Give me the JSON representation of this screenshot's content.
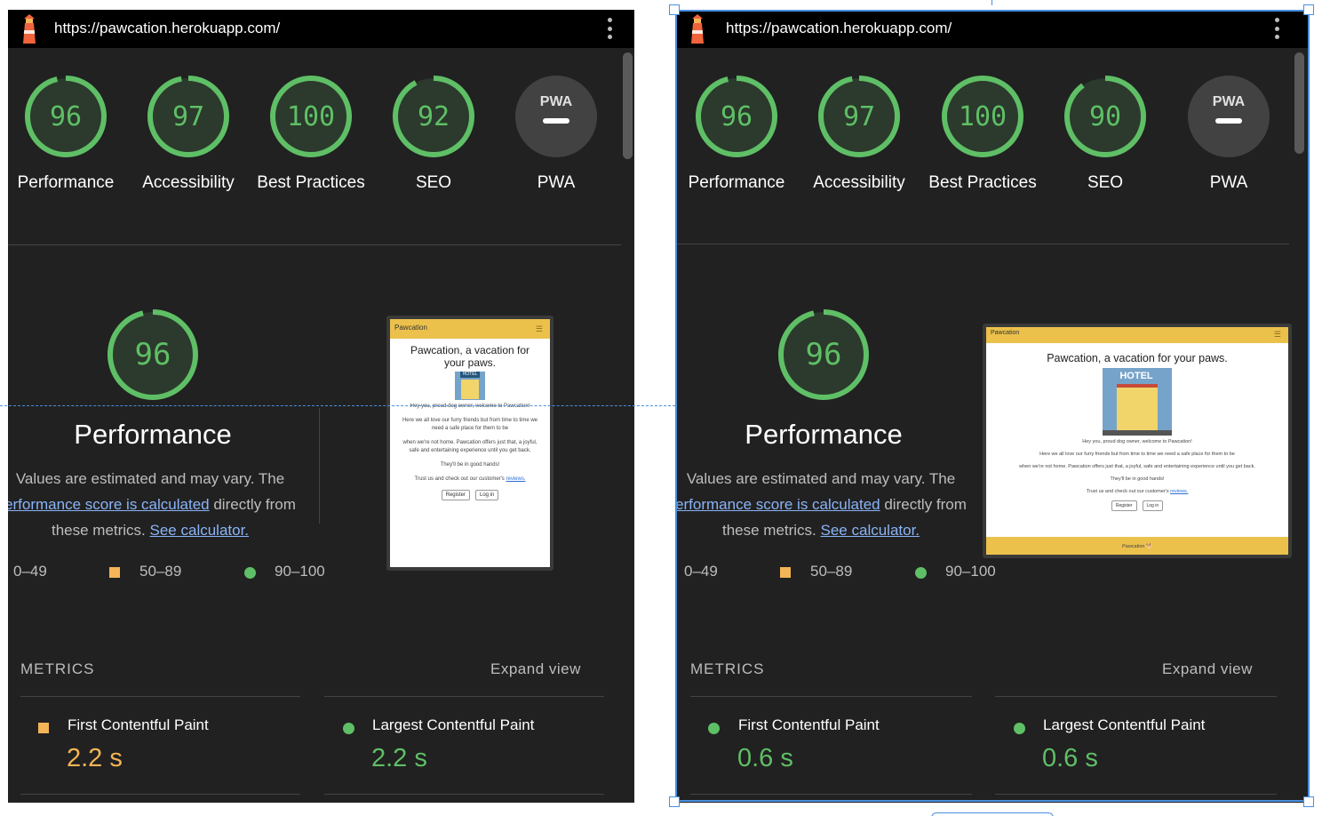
{
  "colors": {
    "good": "#5fbf66",
    "average": "#f4b557",
    "bg": "#212121",
    "link": "#8ab4f8",
    "selection": "#4a8fe0"
  },
  "reports": [
    {
      "url": "https://pawcation.herokuapp.com/",
      "categories": [
        {
          "score": "96",
          "label": "Performance"
        },
        {
          "score": "97",
          "label": "Accessibility"
        },
        {
          "score": "100",
          "label": "Best Practices"
        },
        {
          "score": "92",
          "label": "SEO"
        },
        {
          "score": "PWA",
          "label": "PWA"
        }
      ],
      "performance": {
        "score": "96",
        "title": "Performance",
        "desc_1": "Values are estimated and may vary. The",
        "desc_link_1": "erformance score is calculated",
        "desc_2": "directly from",
        "desc_3": "these metrics.",
        "desc_link_2": "See calculator."
      },
      "legend": [
        "0–49",
        "50–89",
        "90–100"
      ],
      "screenshot": {
        "brand": "Pawcation",
        "heading": "Pawcation, a vacation for your paws.",
        "hotel_sign": "HOTEL",
        "p1": "Hey you, proud dog owner, welcome to Pawcation!",
        "p2": "Here we all love our furry friends but from time to time we need a safe place for them to be",
        "p3": "when we're not home. Pawcation offers just that, a joyful, safe and entertaining experience until you get back.",
        "p4": "They'll be in good hands!",
        "p5": "Trust us and check out our customer's",
        "p5_link": "reviews.",
        "register": "Register",
        "login": "Log in"
      },
      "metrics_title": "METRICS",
      "expand": "Expand view",
      "metrics": [
        {
          "name": "First Contentful Paint",
          "value": "2.2 s",
          "rating": "average"
        },
        {
          "name": "Largest Contentful Paint",
          "value": "2.2 s",
          "rating": "good"
        }
      ]
    },
    {
      "url": "https://pawcation.herokuapp.com/",
      "categories": [
        {
          "score": "96",
          "label": "Performance"
        },
        {
          "score": "97",
          "label": "Accessibility"
        },
        {
          "score": "100",
          "label": "Best Practices"
        },
        {
          "score": "90",
          "label": "SEO"
        },
        {
          "score": "PWA",
          "label": "PWA"
        }
      ],
      "performance": {
        "score": "96",
        "title": "Performance",
        "desc_1": "Values are estimated and may vary. The",
        "desc_link_1": "erformance score is calculated",
        "desc_2": "directly from",
        "desc_3": "these metrics.",
        "desc_link_2": "See calculator."
      },
      "legend": [
        "0–49",
        "50–89",
        "90–100"
      ],
      "screenshot": {
        "brand": "Pawcation",
        "heading": "Pawcation, a vacation for your paws.",
        "hotel_sign": "HOTEL",
        "p1": "Hey you, proud dog owner, welcome to Pawcation!",
        "p2": "Here we all love our furry friends but from time to time we need a safe place for them to be",
        "p3": "when we're not home. Pawcation offers just that, a joyful, safe and entertaining experience until you get back.",
        "p4": "They'll be in good hands!",
        "p5": "Trust us and check out our customer's",
        "p5_link": "reviews.",
        "register": "Register",
        "login": "Log in",
        "footer": "Pawcation 🐕"
      },
      "metrics_title": "METRICS",
      "expand": "Expand view",
      "metrics": [
        {
          "name": "First Contentful Paint",
          "value": "0.6 s",
          "rating": "good"
        },
        {
          "name": "Largest Contentful Paint",
          "value": "0.6 s",
          "rating": "good"
        }
      ]
    }
  ]
}
